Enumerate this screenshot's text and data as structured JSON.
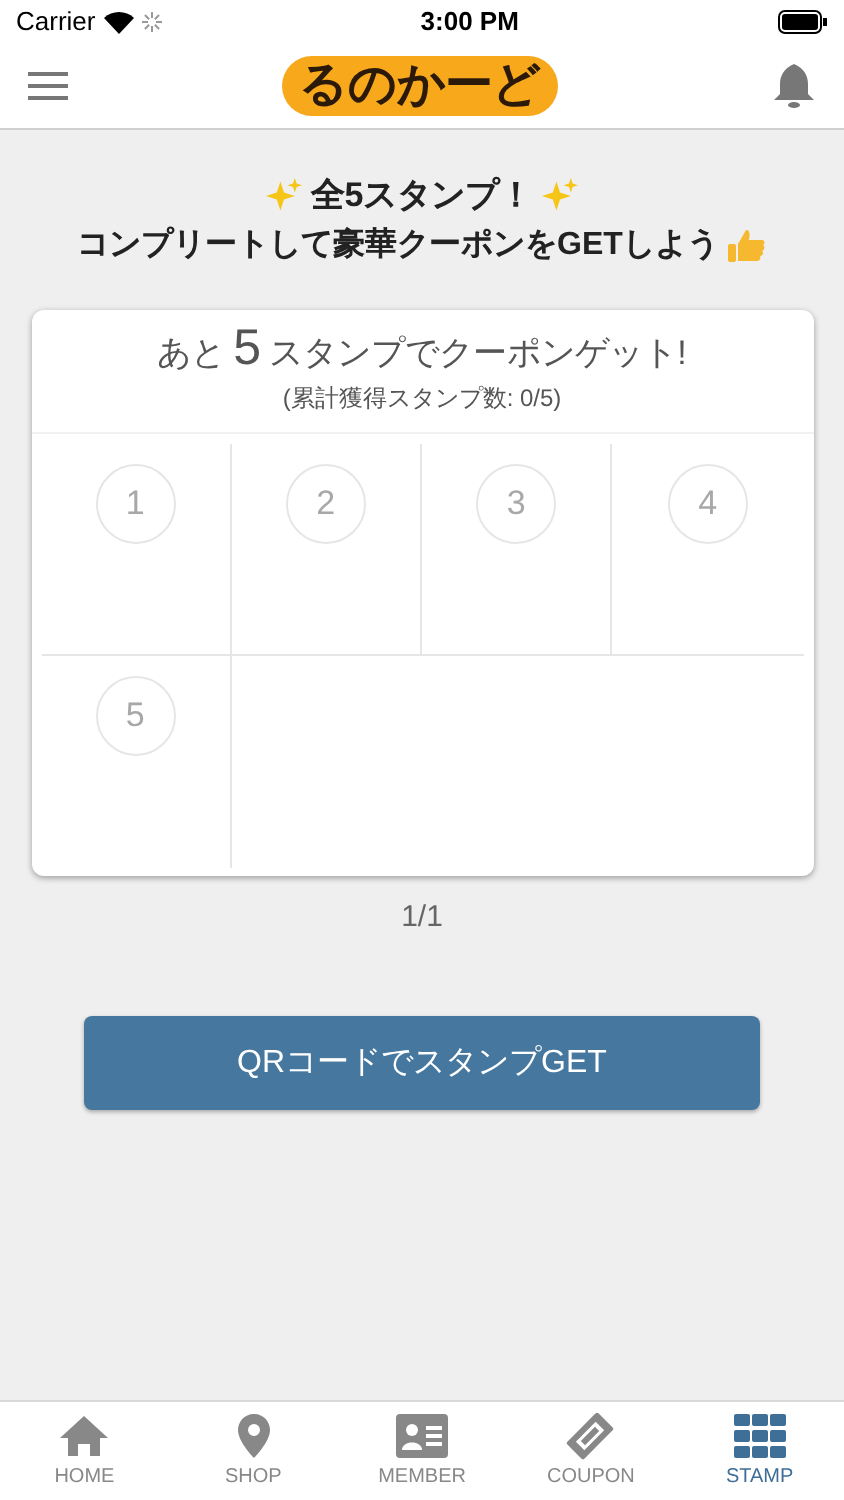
{
  "status_bar": {
    "carrier": "Carrier",
    "time": "3:00 PM"
  },
  "header": {
    "logo": "るのかーど"
  },
  "intro": {
    "line_1": "全5スタンプ！",
    "line_2": "コンプリートして豪華クーポンをGETしよう"
  },
  "card": {
    "prefix": "あと",
    "count": "5",
    "suffix": "スタンプでクーポンゲット!",
    "subtitle": "(累計獲得スタンプ数: 0/5)",
    "stamps": [
      {
        "number": "1"
      },
      {
        "number": "2"
      },
      {
        "number": "3"
      },
      {
        "number": "4"
      },
      {
        "number": "5"
      }
    ]
  },
  "pager": "1/1",
  "qr_button": "QRコードでスタンプGET",
  "tabs": [
    {
      "label": "HOME",
      "kind": "home",
      "selected": false
    },
    {
      "label": "SHOP",
      "kind": "shop",
      "selected": false
    },
    {
      "label": "MEMBER",
      "kind": "member",
      "selected": false
    },
    {
      "label": "COUPON",
      "kind": "coupon",
      "selected": false
    },
    {
      "label": "STAMP",
      "kind": "stamp",
      "selected": true
    }
  ]
}
